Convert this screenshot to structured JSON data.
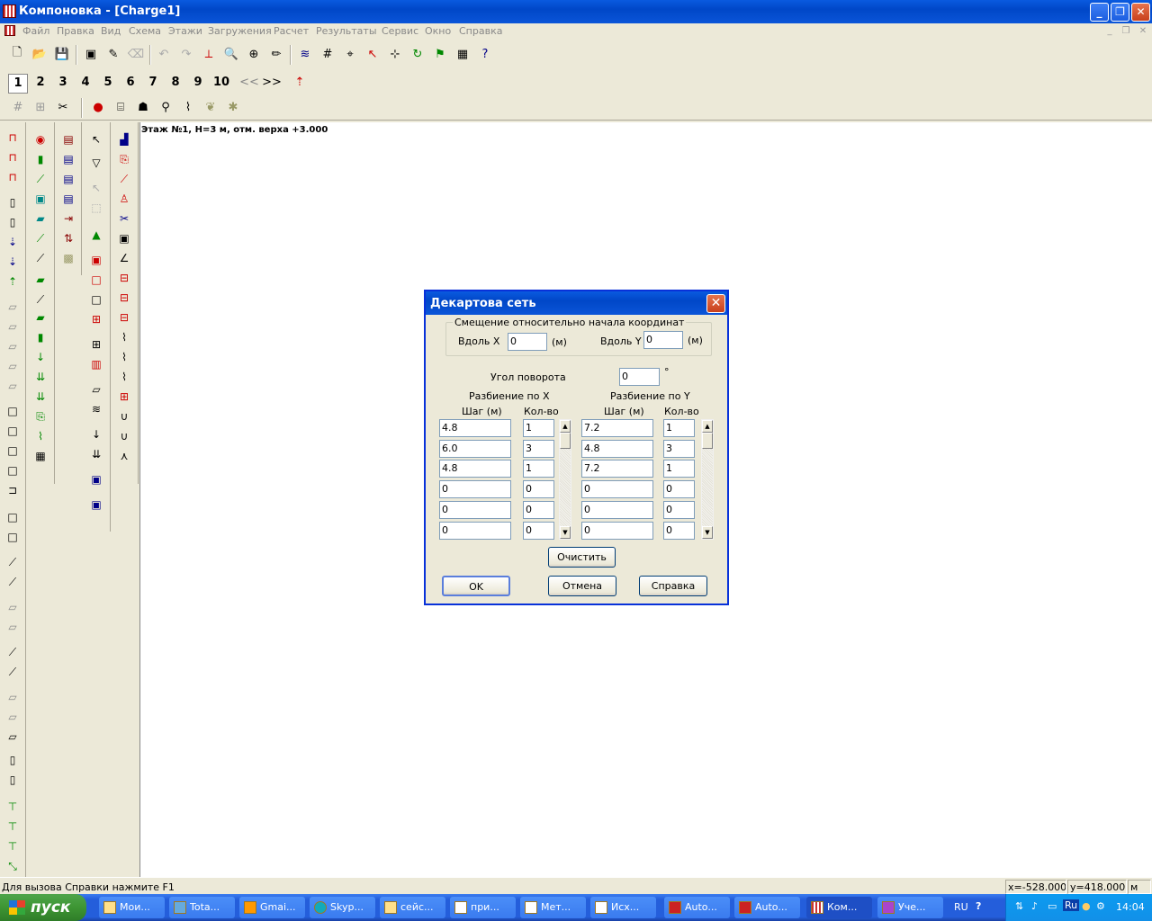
{
  "window": {
    "title": "Компоновка - [Charge1]"
  },
  "menu": [
    "Файл",
    "Правка",
    "Вид",
    "Схема",
    "Этажи",
    "Загружения",
    "Расчет",
    "Результаты",
    "Сервис",
    "Окно",
    "Справка"
  ],
  "floors": [
    "1",
    "2",
    "3",
    "4",
    "5",
    "6",
    "7",
    "8",
    "9",
    "10"
  ],
  "floor_nav": {
    "prev": "<<",
    "next": ">>"
  },
  "canvas": {
    "floor_label": "Этаж №1, H=3 м, отм. верха +3.000"
  },
  "dialog": {
    "title": "Декартова сеть",
    "offset_group": "Смещение относительно начала координат",
    "along_x_label": "Вдоль X",
    "along_x_value": "0",
    "along_y_label": "Вдоль Y",
    "along_y_value": "0",
    "unit_m": "(м)",
    "angle_label": "Угол поворота",
    "angle_value": "0",
    "degree": "°",
    "split_x_label": "Разбиение по X",
    "split_y_label": "Разбиение по Y",
    "step_header": "Шаг (м)",
    "count_header": "Кол-во",
    "x_rows": [
      {
        "step": "4.8",
        "count": "1"
      },
      {
        "step": "6.0",
        "count": "3"
      },
      {
        "step": "4.8",
        "count": "1"
      },
      {
        "step": "0",
        "count": "0"
      },
      {
        "step": "0",
        "count": "0"
      },
      {
        "step": "0",
        "count": "0"
      }
    ],
    "y_rows": [
      {
        "step": "7.2",
        "count": "1"
      },
      {
        "step": "4.8",
        "count": "3"
      },
      {
        "step": "7.2",
        "count": "1"
      },
      {
        "step": "0",
        "count": "0"
      },
      {
        "step": "0",
        "count": "0"
      },
      {
        "step": "0",
        "count": "0"
      }
    ],
    "clear_button": "Очистить",
    "ok_button": "OK",
    "cancel_button": "Отмена",
    "help_button": "Справка"
  },
  "status": {
    "message": "Для вызова Справки нажмите F1",
    "x_coord": "x=-528.0000",
    "y_coord": "y=418.0000(",
    "units": "м"
  },
  "taskbar": {
    "start": "пуск",
    "tasks": [
      "Мои...",
      "Tota...",
      "Gmai...",
      "Skyp...",
      "сейс...",
      "при...",
      "Мет...",
      "Исх...",
      "Auto...",
      "Auto...",
      "Ком...",
      "Уче..."
    ],
    "active_index": 10,
    "lang": "RU",
    "tray_lang": "Ru",
    "clock": "14:04"
  }
}
